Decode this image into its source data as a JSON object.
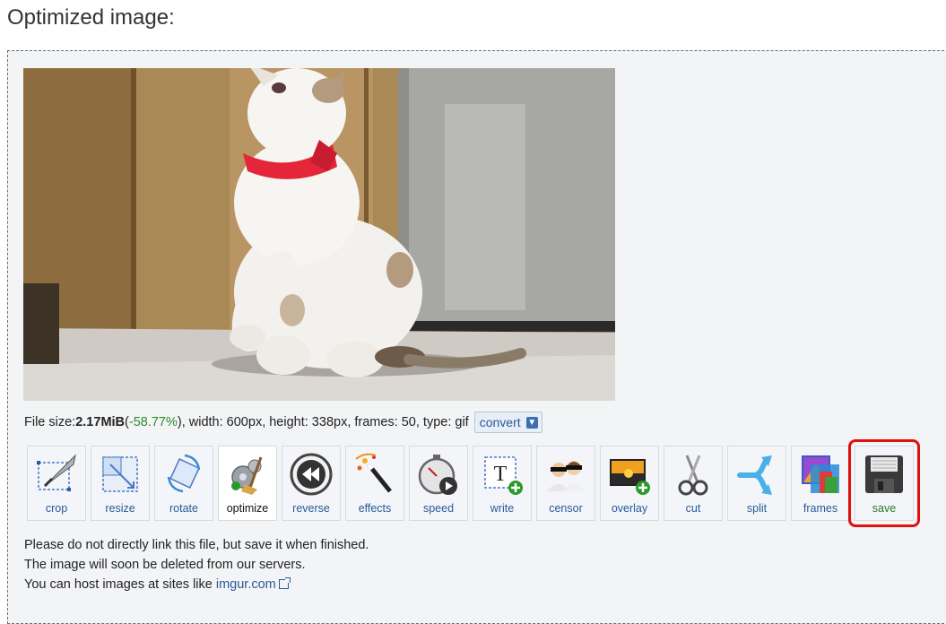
{
  "page": {
    "title": "Optimized image:"
  },
  "preview": {
    "alt": "cat with red bow"
  },
  "file_info": {
    "prefix": "File size: ",
    "size": "2.17MiB",
    "open_paren": " (",
    "percent": "-58.77%",
    "rest": "), width: 600px, height: 338px, frames: 50, type: gif",
    "convert_label": "convert"
  },
  "toolbar": {
    "tools": [
      {
        "label": "crop",
        "icon": "crop-icon"
      },
      {
        "label": "resize",
        "icon": "resize-icon"
      },
      {
        "label": "rotate",
        "icon": "rotate-icon"
      },
      {
        "label": "optimize",
        "icon": "optimize-icon",
        "active": true
      },
      {
        "label": "reverse",
        "icon": "reverse-icon"
      },
      {
        "label": "effects",
        "icon": "effects-icon"
      },
      {
        "label": "speed",
        "icon": "speed-icon"
      },
      {
        "label": "write",
        "icon": "write-icon"
      },
      {
        "label": "censor",
        "icon": "censor-icon"
      },
      {
        "label": "overlay",
        "icon": "overlay-icon"
      },
      {
        "label": "cut",
        "icon": "cut-icon"
      },
      {
        "label": "split",
        "icon": "split-icon"
      },
      {
        "label": "frames",
        "icon": "frames-icon"
      },
      {
        "label": "save",
        "icon": "save-icon",
        "highlighted": true
      }
    ]
  },
  "notes": {
    "line1": "Please do not directly link this file, but save it when finished.",
    "line2": "The image will soon be deleted from our servers.",
    "line3_prefix": "You can host images at sites like ",
    "line3_link": "imgur.com"
  },
  "colors": {
    "highlight": "#e01010",
    "link": "#2a5a9a",
    "percent": "#2d8a2d"
  }
}
